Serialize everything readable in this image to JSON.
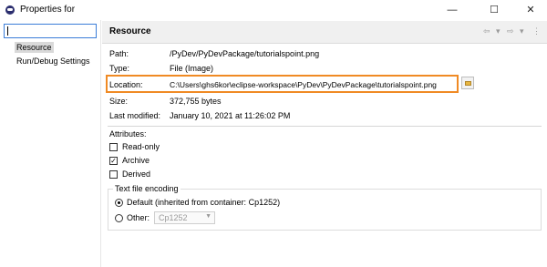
{
  "window": {
    "title": "Properties for",
    "minimize_glyph": "—",
    "maximize_glyph": "☐",
    "close_glyph": "✕"
  },
  "nav": {
    "search_value": "",
    "items": [
      "Resource",
      "Run/Debug Settings"
    ],
    "selected_index": 0
  },
  "page": {
    "title": "Resource",
    "back_icon": "back-arrow-icon",
    "forward_icon": "forward-arrow-icon",
    "dropdown_icon": "chevron-down-icon",
    "menu_icon": "view-menu-icon",
    "nav_glyphs": {
      "back": "⇦",
      "dropdown": "▾",
      "forward": "⇨",
      "menu": "⋮"
    }
  },
  "properties": {
    "path_label": "Path:",
    "path_value": "/PyDev/PyDevPackage/tutorialspoint.png",
    "type_label": "Type:",
    "type_value": "File  (Image)",
    "location_label": "Location:",
    "location_value": "C:\\Users\\ghs6kor\\eclipse-workspace\\PyDev\\PyDevPackage\\tutorialspoint.png",
    "size_label": "Size:",
    "size_value": "372,755  bytes",
    "modified_label": "Last modified:",
    "modified_value": "January 10, 2021 at 11:26:02 PM"
  },
  "attributes": {
    "heading": "Attributes:",
    "items": [
      {
        "label": "Read-only",
        "checked": false
      },
      {
        "label": "Archive",
        "checked": true
      },
      {
        "label": "Derived",
        "checked": false
      }
    ],
    "check_glyph": "✓"
  },
  "encoding": {
    "heading": "Text file encoding",
    "default_label": "Default (inherited from container: Cp1252)",
    "other_label": "Other:",
    "other_value": "Cp1252",
    "selected": "default"
  },
  "colors": {
    "highlight_border": "#f08a24",
    "selection_bg": "#d9d9d9",
    "focus_border": "#3b7dd8"
  }
}
